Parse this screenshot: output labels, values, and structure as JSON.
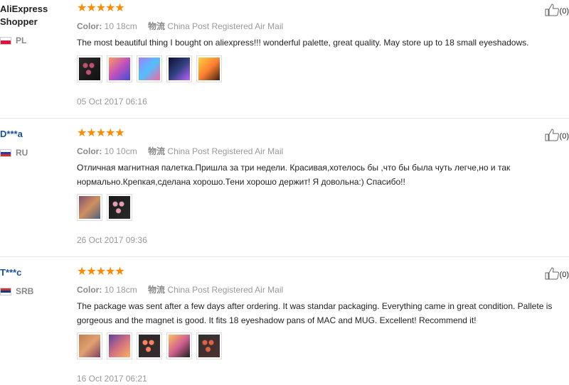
{
  "reviews": [
    {
      "user": "AliExpress Shopper",
      "user_line1": "AliExpress",
      "user_line2": "Shopper",
      "country_code": "PL",
      "flag_colors": [
        "#ffffff",
        "#dc143c"
      ],
      "rating": 5,
      "stars": "★★★★★",
      "color_label": "Color:",
      "color_value": "10 18cm",
      "shipping_label": "物流",
      "shipping_value": "China Post Registered Air Mail",
      "text": "The most beautiful thing I bought on aliexpress!!! wonderful palette, great quality. May store up to 18 small eyeshadows.",
      "photos": [
        {
          "icon": "eyeshadow-palette-photo",
          "bg": "linear-gradient(135deg,#2a2a2a,#111)",
          "accent": "#c05070"
        },
        {
          "icon": "holographic-palette-photo",
          "bg": "linear-gradient(135deg,#ff9a5a,#c050c0,#4050d0)"
        },
        {
          "icon": "holographic-palette-photo",
          "bg": "linear-gradient(135deg,#a080ff,#50c0ff,#ff60a0)"
        },
        {
          "icon": "holographic-palette-photo",
          "bg": "linear-gradient(135deg,#101030,#304080,#c060ff)"
        },
        {
          "icon": "holographic-palette-photo",
          "bg": "linear-gradient(135deg,#ffd040,#ff8030,#402010)"
        }
      ],
      "date": "05 Oct 2017 06:16",
      "helpful_count": "(0)"
    },
    {
      "user": "D***a",
      "country_code": "RU",
      "flag_colors": [
        "#ffffff",
        "#1c3faa",
        "#d52b1e"
      ],
      "rating": 5,
      "stars": "★★★★★",
      "color_label": "Color:",
      "color_value": "10 10cm",
      "shipping_label": "物流",
      "shipping_value": "China Post Registered Air Mail",
      "text": "Отличная магнитная палетка.Пришла за три недели. Красивая,хотелось бы ,что бы была чуть легче,но и так нормально.Крепкая,сделана хорошо.Тени хорошо держит! Я довольна:) Спасибо!!",
      "photos": [
        {
          "icon": "holographic-palette-photo",
          "bg": "linear-gradient(135deg,#805070,#d09060,#506080)"
        },
        {
          "icon": "eyeshadow-palette-photo",
          "bg": "linear-gradient(135deg,#1a1a1a,#2a2a2a)",
          "accent": "#e0a0b0"
        }
      ],
      "date": "26 Oct 2017 09:36",
      "helpful_count": "(0)"
    },
    {
      "user": "T***c",
      "country_code": "SRB",
      "flag_colors": [
        "#c6363c",
        "#0c4076",
        "#ffffff"
      ],
      "rating": 5,
      "stars": "★★★★★",
      "color_label": "Color:",
      "color_value": "10 18cm",
      "shipping_label": "物流",
      "shipping_value": "China Post Registered Air Mail",
      "text": "The package was sent after a few days after ordering. It was standar packaging. Everything came in great condition. Pallete is gorgeous and the magnet is good. It fits 18 eyeshadow pans of MAC and MUG. Excellent! Recommend it!",
      "photos": [
        {
          "icon": "holographic-palette-photo",
          "bg": "linear-gradient(135deg,#c08050,#e0a070,#804060)"
        },
        {
          "icon": "holographic-palette-photo",
          "bg": "linear-gradient(135deg,#6040a0,#d07080,#ffb060)"
        },
        {
          "icon": "eyeshadow-palette-photo",
          "bg": "linear-gradient(135deg,#2a2a2a,#3a2a2a)",
          "accent": "#ff8060"
        },
        {
          "icon": "holographic-palette-photo",
          "bg": "linear-gradient(135deg,#ffc060,#d06090,#202020)"
        },
        {
          "icon": "eyeshadow-palette-photo",
          "bg": "linear-gradient(135deg,#303030,#503030)",
          "accent": "#e06040"
        }
      ],
      "date": "16 Oct 2017 06:21",
      "helpful_count": "(0)"
    }
  ]
}
